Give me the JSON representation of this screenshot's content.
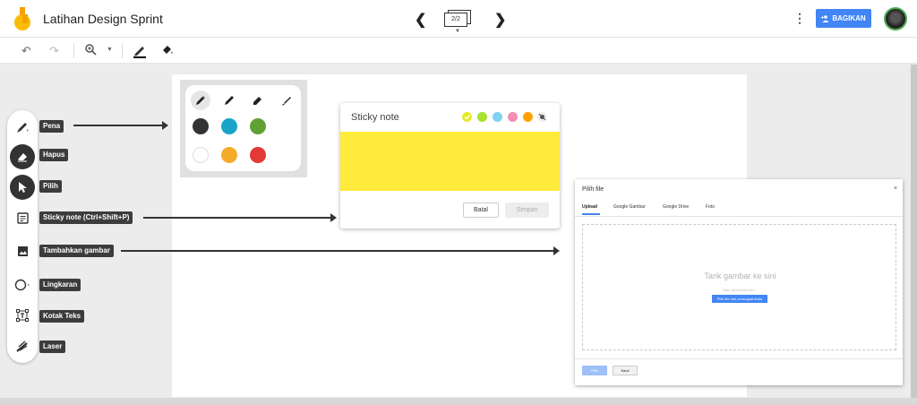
{
  "header": {
    "title": "Latihan Design Sprint",
    "frame_indicator": "2/2",
    "share_label": "BAGIKAN",
    "icons": [
      "jamboard-logo-icon",
      "chevron-left-icon",
      "chevron-right-icon",
      "frames-icon",
      "more-vert-icon",
      "share-person-icon",
      "avatar"
    ]
  },
  "toolbar": {
    "icons": [
      "undo-icon",
      "redo-icon",
      "zoom-icon",
      "zoom-dropdown-icon",
      "pen-color-icon",
      "fill-icon"
    ]
  },
  "tools": [
    {
      "name": "pen",
      "label": "Pena"
    },
    {
      "name": "eraser",
      "label": "Hapus"
    },
    {
      "name": "select",
      "label": "Pilih"
    },
    {
      "name": "sticky-note",
      "label": "Sticky note (Ctrl+Shift+P)"
    },
    {
      "name": "add-image",
      "label": "Tambahkan gambar"
    },
    {
      "name": "circle",
      "label": "Lingkaran"
    },
    {
      "name": "text-box",
      "label": "Kotak Teks"
    },
    {
      "name": "laser",
      "label": "Laser"
    }
  ],
  "pen_palette": {
    "pens": [
      "marker-icon",
      "pen-icon",
      "highlighter-icon",
      "brush-icon"
    ],
    "colors": [
      "#333333",
      "#1aa3c9",
      "#5fa233",
      "#ffffff",
      "#f5ab2a",
      "#e53935"
    ]
  },
  "sticky_note": {
    "title": "Sticky note",
    "colors": [
      "#e5e82c",
      "#a6e22e",
      "#7dd3f0",
      "#f48fb1",
      "#ffa000"
    ],
    "note_color": "#ffeb3b",
    "cancel_label": "Batal",
    "save_label": "Simpan"
  },
  "file_picker": {
    "title": "Pilih file",
    "close": "×",
    "tabs": [
      "Upload",
      "Google Gambar",
      "Google Drive",
      "Foto"
    ],
    "drop_text": "Tarik gambar ke sini",
    "drop_sub": "Atau, jika Anda mau...",
    "device_button": "Pilih file dari perangkat Anda",
    "select_label": "Pilih",
    "cancel_label": "Batal"
  },
  "colors": {
    "accent": "#4285f4"
  }
}
